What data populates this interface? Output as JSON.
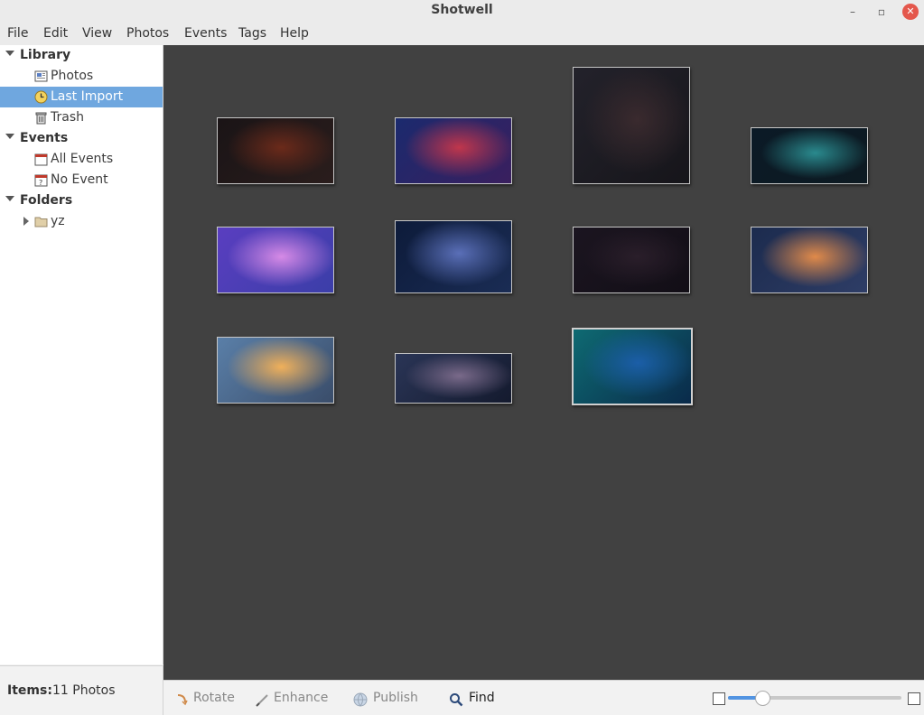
{
  "window": {
    "title": "Shotwell",
    "close_color": "#e4574c"
  },
  "menu": [
    "File",
    "Edit",
    "View",
    "Photos",
    "Events",
    "Tags",
    "Help"
  ],
  "sidebar": {
    "library_header": "Library",
    "photos": "Photos",
    "last_import": "Last Import",
    "trash": "Trash",
    "events_header": "Events",
    "all_events": "All Events",
    "no_event": "No Event",
    "folders_header": "Folders",
    "folder_yz": "yz"
  },
  "status": {
    "items_label": "Items:",
    "items_value": "11 Photos"
  },
  "toolbar": {
    "rotate": "Rotate",
    "enhance": "Enhance",
    "publish": "Publish",
    "find": "Find",
    "zoom_level": 0.2
  },
  "photos": [
    {
      "name": "spiral-galaxy-dark",
      "colors": [
        "#1a1416",
        "#6b2a1a",
        "#2a1d1c"
      ]
    },
    {
      "name": "tree-sunset",
      "colors": [
        "#1b2a6e",
        "#c0364c",
        "#3a1f5e"
      ]
    },
    {
      "name": "glowing-triangle",
      "colors": [
        "#23222b",
        "#3a2a2e",
        "#16151a"
      ]
    },
    {
      "name": "teal-nebula-cave",
      "colors": [
        "#0b1a26",
        "#2a8a8e",
        "#0d1a22"
      ]
    },
    {
      "name": "purple-light-rays",
      "colors": [
        "#5a3ec0",
        "#d68ae6",
        "#3b3ea8"
      ]
    },
    {
      "name": "blue-cosmos",
      "colors": [
        "#0d1b3a",
        "#5a6fb8",
        "#1a2c54"
      ]
    },
    {
      "name": "dark-space-rock",
      "colors": [
        "#1b1520",
        "#2a1e2a",
        "#120e16"
      ]
    },
    {
      "name": "city-skyline",
      "colors": [
        "#1c2b4e",
        "#e08a4a",
        "#2e3d66"
      ]
    },
    {
      "name": "golden-clouds",
      "colors": [
        "#5a7fa8",
        "#f0b05a",
        "#3a4d6a"
      ]
    },
    {
      "name": "window-scene",
      "colors": [
        "#2a3556",
        "#7a6a8a",
        "#141a2e"
      ]
    },
    {
      "name": "teal-blue-space",
      "colors": [
        "#0e6a72",
        "#1b5ea8",
        "#0a2a4a"
      ]
    }
  ]
}
